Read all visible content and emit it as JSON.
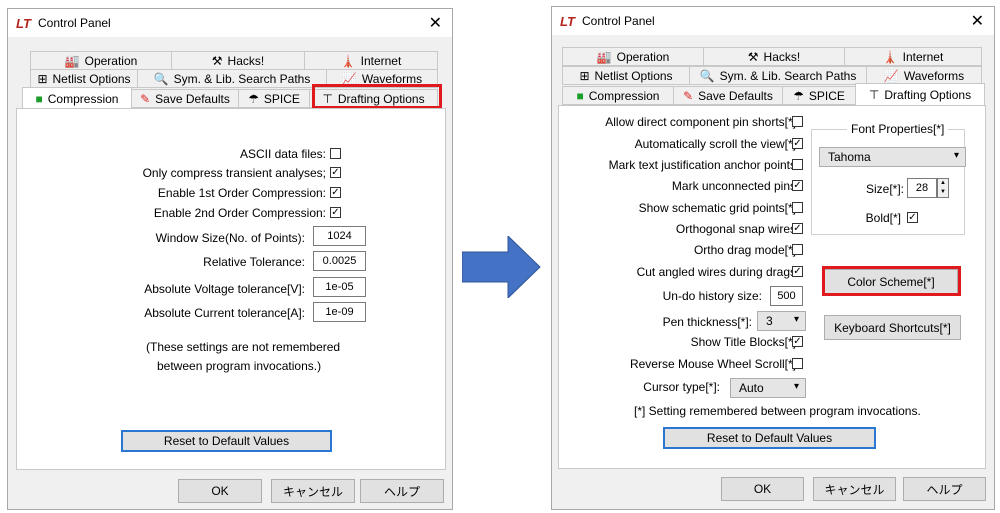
{
  "left": {
    "title": "Control Panel",
    "app_icon": "LT",
    "close": "✕",
    "tabs_row1": [
      "Operation",
      "Hacks!",
      "Internet"
    ],
    "tabs_row2": [
      "Netlist Options",
      "Sym. & Lib. Search Paths",
      "Waveforms"
    ],
    "tabs_row3": [
      "Compression",
      "Save Defaults",
      "SPICE",
      "Drafting Options"
    ],
    "checkboxes": [
      {
        "label": "ASCII data files:",
        "checked": false,
        "mark": ""
      },
      {
        "label": "Only compress transient analyses;",
        "checked": true,
        "mark": "✓"
      },
      {
        "label": "Enable 1st Order Compression:",
        "checked": true,
        "mark": "✓"
      },
      {
        "label": "Enable 2nd Order Compression:",
        "checked": true,
        "mark": "✓"
      }
    ],
    "fields": [
      {
        "label": "Window Size(No. of Points):",
        "value": "1024"
      },
      {
        "label": "Relative Tolerance:",
        "value": "0.0025"
      },
      {
        "label": "Absolute Voltage tolerance[V]:",
        "value": "1e-05"
      },
      {
        "label": "Absolute Current tolerance[A]:",
        "value": "1e-09"
      }
    ],
    "note_line1": "(These settings are not remembered",
    "note_line2": "between program invocations.)",
    "reset": "Reset to Default Values",
    "ok": "OK",
    "cancel": "キャンセル",
    "help": "ヘルプ"
  },
  "right": {
    "title": "Control Panel",
    "app_icon": "LT",
    "close": "✕",
    "tabs_row1": [
      "Operation",
      "Hacks!",
      "Internet"
    ],
    "tabs_row2": [
      "Netlist Options",
      "Sym. & Lib. Search Paths",
      "Waveforms"
    ],
    "tabs_row3": [
      "Compression",
      "Save Defaults",
      "SPICE",
      "Drafting Options"
    ],
    "checkboxes": [
      {
        "label": "Allow direct component pin shorts[*]",
        "mark": ""
      },
      {
        "label": "Automatically scroll the view[*]",
        "mark": "✓"
      },
      {
        "label": "Mark text justification anchor points",
        "mark": ""
      },
      {
        "label": "Mark unconnected pins",
        "mark": "✓"
      },
      {
        "label": "Show schematic grid points[*]",
        "mark": ""
      },
      {
        "label": "Orthogonal snap wires",
        "mark": "✓"
      },
      {
        "label": "Ortho drag mode[*]",
        "mark": ""
      },
      {
        "label": "Cut angled wires during drags",
        "mark": "✓"
      }
    ],
    "undo_label": "Un-do history size:",
    "undo_value": "500",
    "pen_label": "Pen thickness[*]:",
    "pen_value": "3",
    "title_blocks": {
      "label": "Show Title Blocks[*]",
      "mark": "✓"
    },
    "reverse_wheel": {
      "label": "Reverse Mouse Wheel Scroll[*]",
      "mark": ""
    },
    "cursor_label": "Cursor type[*]:",
    "cursor_value": "Auto",
    "font_group": "Font Properties[*]",
    "font_name": "Tahoma",
    "size_label": "Size[*]:",
    "size_value": "28",
    "bold_label": "Bold[*]",
    "bold_mark": "✓",
    "color_scheme": "Color Scheme[*]",
    "keyboard": "Keyboard Shortcuts[*]",
    "note": "[*] Setting remembered between program invocations.",
    "reset": "Reset to Default Values",
    "ok": "OK",
    "cancel": "キャンセル",
    "help": "ヘルプ"
  },
  "colors": {
    "highlight": "#e0191f",
    "arrow": "#4472c4",
    "focus": "#2a77d1"
  }
}
